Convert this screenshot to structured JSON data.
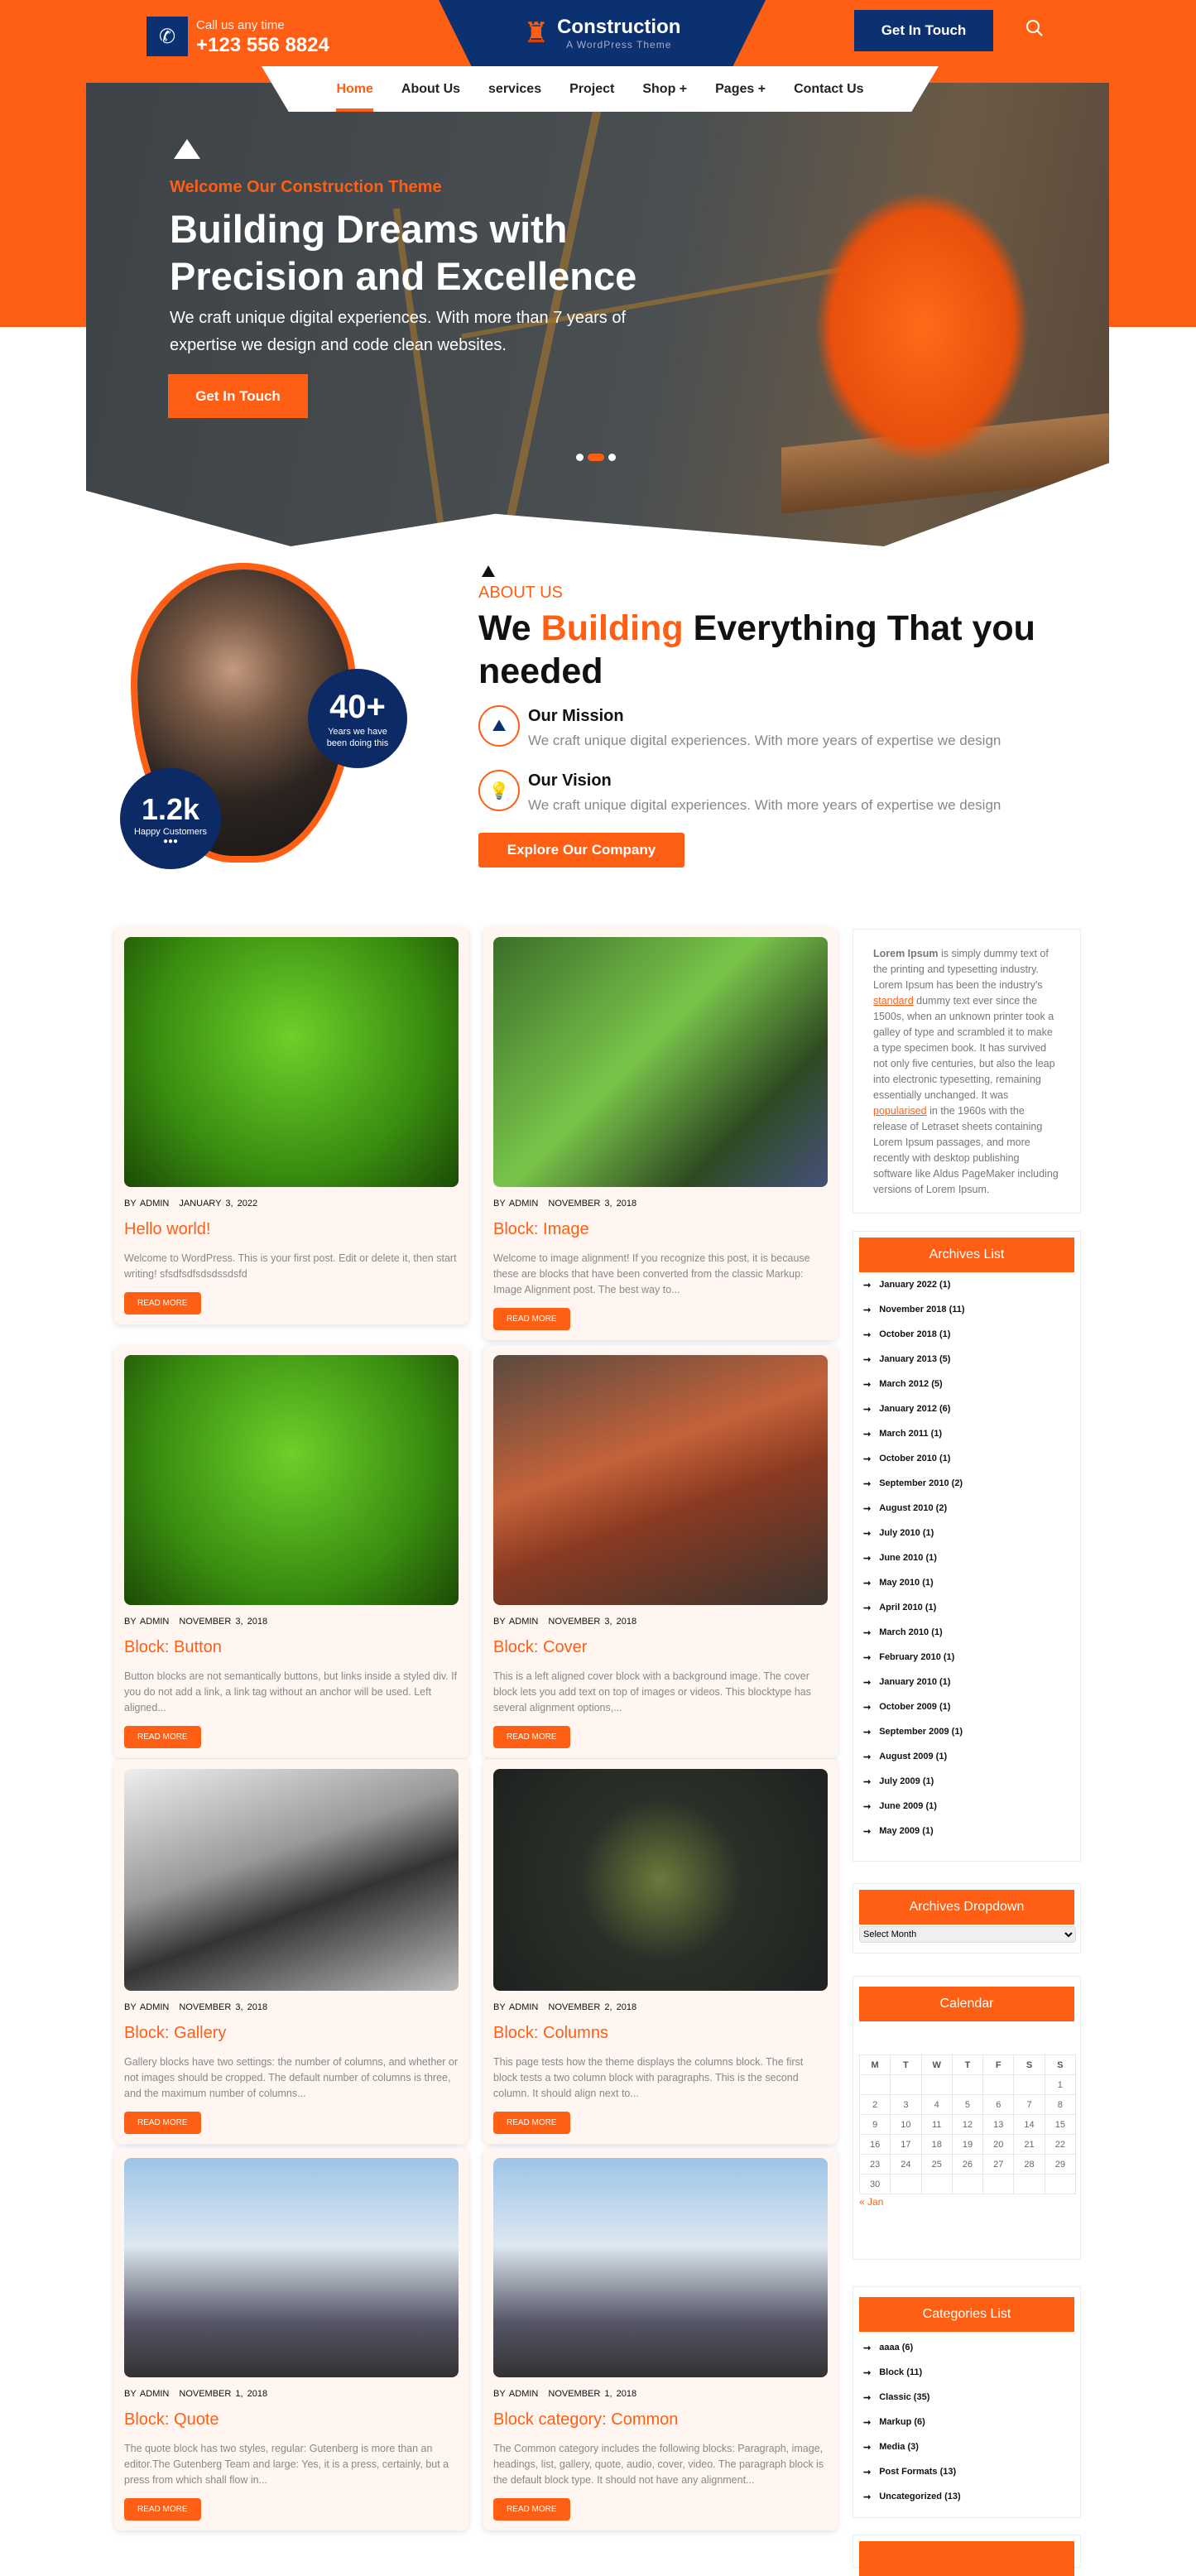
{
  "header": {
    "call_label": "Call us any time",
    "phone": "+123 556 8824",
    "logo_title": "Construction",
    "logo_subtitle": "A WordPress Theme",
    "cta": "Get In Touch"
  },
  "nav": [
    {
      "label": "Home",
      "active": true
    },
    {
      "label": "About Us"
    },
    {
      "label": "services"
    },
    {
      "label": "Project"
    },
    {
      "label": "Shop +"
    },
    {
      "label": "Pages +"
    },
    {
      "label": "Contact Us"
    }
  ],
  "hero": {
    "eyebrow": "Welcome Our Construction Theme",
    "title": "Building Dreams with Precision and Excellence",
    "text": "We craft unique digital experiences. With more than 7 years of expertise we design and code clean websites.",
    "button": "Get In Touch",
    "slides": 3,
    "active_slide": 2
  },
  "about": {
    "label": "ABOUT US",
    "title_pre": "We ",
    "title_accent": "Building",
    "title_post": " Everything That you needed",
    "stat1_value": "40+",
    "stat1_label": "Years we have been doing this",
    "stat2_value": "1.2k",
    "stat2_label": "Happy Customers",
    "features": [
      {
        "title": "Our Mission",
        "text": "We craft unique digital experiences. With more years of expertise we design",
        "icon": "mountain-flag-icon"
      },
      {
        "title": "Our Vision",
        "text": "We craft unique digital experiences. With more years of expertise we design",
        "icon": "lightbulb-hand-icon"
      }
    ],
    "button": "Explore Our Company"
  },
  "posts": [
    {
      "author": "BY ADMIN",
      "date": "JANUARY 3, 2022",
      "title": "Hello world!",
      "excerpt": "Welcome to WordPress. This is your first post. Edit or delete it, then start writing! sfsdfsdfsdsdssdsfd",
      "button": "READ MORE"
    },
    {
      "author": "BY ADMIN",
      "date": "NOVEMBER 3, 2018",
      "title": "Block: Image",
      "excerpt": "Welcome to image alignment! If you recognize this post, it is because these are blocks that have been converted from the classic Markup: Image Alignment post. The best way to...",
      "button": "READ MORE"
    },
    {
      "author": "BY ADMIN",
      "date": "NOVEMBER 3, 2018",
      "title": "Block: Button",
      "excerpt": "Button blocks are not semantically buttons, but links inside a styled div.  If you do not add a link, a link tag without an anchor will be used. Left aligned...",
      "button": "READ MORE"
    },
    {
      "author": "BY ADMIN",
      "date": "NOVEMBER 3, 2018",
      "title": "Block: Cover",
      "excerpt": "This is a left aligned cover block with a background image. The cover block lets you add text on top of images or videos. This blocktype has several alignment options,...",
      "button": "READ MORE"
    },
    {
      "author": "BY ADMIN",
      "date": "NOVEMBER 3, 2018",
      "title": "Block: Gallery",
      "excerpt": "Gallery blocks have two settings: the number of columns, and whether or not images should be cropped. The default number of columns is three, and the maximum number of columns...",
      "button": "READ MORE"
    },
    {
      "author": "BY ADMIN",
      "date": "NOVEMBER 2, 2018",
      "title": "Block: Columns",
      "excerpt": "This page tests how the theme displays the columns block. The first block tests a two column block with paragraphs. This is the second column. It should align next to...",
      "button": "READ MORE"
    },
    {
      "author": "BY ADMIN",
      "date": "NOVEMBER 1, 2018",
      "title": "Block: Quote",
      "excerpt": "The quote block has two styles, regular: Gutenberg is more than an editor.The Gutenberg Team and large: Yes, it is a press, certainly, but a press from which shall flow in...",
      "button": "READ MORE"
    },
    {
      "author": "BY ADMIN",
      "date": "NOVEMBER 1, 2018",
      "title": "Block category: Common",
      "excerpt": "The Common category includes the following blocks: Paragraph, image, headings, list, gallery, quote, audio, cover, video. The paragraph block is the default block type.  It should not have any alignment...",
      "button": "READ MORE"
    }
  ],
  "sidebar": {
    "text": {
      "bold": "Lorem Ipsum",
      "p1": " is simply dummy text of the printing and typesetting industry. Lorem Ipsum has been the industry's ",
      "link1": "standard",
      "p2": " dummy text ever since the 1500s, when an unknown printer took a galley of type and scrambled it to make a type specimen book. It has survived not only five centuries, but also the leap into electronic typesetting, remaining essentially unchanged. It was ",
      "link2": "popularised",
      "p3": " in the 1960s with the release of Letraset sheets containing Lorem Ipsum passages, and more recently with desktop publishing software like Aldus PageMaker including versions of Lorem Ipsum."
    },
    "archives_title": "Archives List",
    "archives": [
      "January 2022 (1)",
      "November 2018 (11)",
      "October 2018 (1)",
      "January 2013 (5)",
      "March 2012 (5)",
      "January 2012 (6)",
      "March 2011 (1)",
      "October 2010 (1)",
      "September 2010 (2)",
      "August 2010 (2)",
      "July 2010 (1)",
      "June 2010 (1)",
      "May 2010 (1)",
      "April 2010 (1)",
      "March 2010 (1)",
      "February 2010 (1)",
      "January 2010 (1)",
      "October 2009 (1)",
      "September 2009 (1)",
      "August 2009 (1)",
      "July 2009 (1)",
      "June 2009 (1)",
      "May 2009 (1)"
    ],
    "dropdown_title": "Archives Dropdown",
    "dropdown_value": "Select Month",
    "calendar_title": "Calendar",
    "calendar_days": [
      "M",
      "T",
      "W",
      "T",
      "F",
      "S",
      "S"
    ],
    "calendar_weeks": [
      [
        "",
        "",
        "",
        "",
        "",
        "",
        "1"
      ],
      [
        "2",
        "3",
        "4",
        "5",
        "6",
        "7",
        "8"
      ],
      [
        "9",
        "10",
        "11",
        "12",
        "13",
        "14",
        "15"
      ],
      [
        "16",
        "17",
        "18",
        "19",
        "20",
        "21",
        "22"
      ],
      [
        "23",
        "24",
        "25",
        "26",
        "27",
        "28",
        "29"
      ],
      [
        "30",
        "",
        "",
        "",
        "",
        "",
        ""
      ]
    ],
    "calendar_prev": "« Jan",
    "categories_title": "Categories List",
    "categories": [
      "aaaa (6)",
      "Block (11)",
      "Classic (35)",
      "Markup (6)",
      "Media (3)",
      "Post Formats (13)",
      "Uncategorized (13)"
    ]
  },
  "colors": {
    "accent": "#ff5f14",
    "navy": "#0b3170",
    "card_bg": "#fff6f2"
  }
}
